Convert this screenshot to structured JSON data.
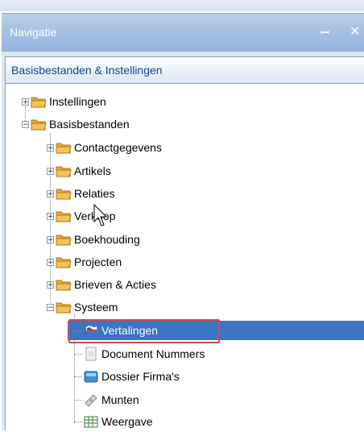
{
  "panel": {
    "title": "Navigatie",
    "pin_glyph": "ꟷ",
    "close_glyph": "✕",
    "header": "Basisbestanden & Instellingen"
  },
  "tree": {
    "items": [
      {
        "label": "Instellingen",
        "state": "collapsed",
        "icon": "folder-icon"
      },
      {
        "label": "Basisbestanden",
        "state": "expanded",
        "icon": "folder-icon"
      },
      {
        "label": "Contactgegevens",
        "state": "collapsed",
        "icon": "folder-icon"
      },
      {
        "label": "Artikels",
        "state": "collapsed",
        "icon": "folder-icon"
      },
      {
        "label": "Relaties",
        "state": "collapsed",
        "icon": "folder-icon"
      },
      {
        "label": "Verkoop",
        "state": "collapsed",
        "icon": "folder-icon"
      },
      {
        "label": "Boekhouding",
        "state": "collapsed",
        "icon": "folder-icon"
      },
      {
        "label": "Projecten",
        "state": "collapsed",
        "icon": "folder-icon"
      },
      {
        "label": "Brieven & Acties",
        "state": "collapsed",
        "icon": "folder-icon"
      },
      {
        "label": "Systeem",
        "state": "expanded",
        "icon": "folder-icon"
      },
      {
        "label": "Vertalingen",
        "state": "leaf-selected",
        "icon": "flags-icon"
      },
      {
        "label": "Document Nummers",
        "state": "leaf",
        "icon": "document-numbers-icon"
      },
      {
        "label": "Dossier Firma's",
        "state": "leaf",
        "icon": "dossier-icon"
      },
      {
        "label": "Munten",
        "state": "leaf",
        "icon": "coins-icon"
      },
      {
        "label": "Weergave",
        "state": "leaf",
        "icon": "grid-icon"
      }
    ]
  },
  "colors": {
    "selection": "#3a75c4",
    "highlight_border": "#d24a48",
    "titlebar": "#a9c2e6",
    "folder": "#e8a93a"
  }
}
